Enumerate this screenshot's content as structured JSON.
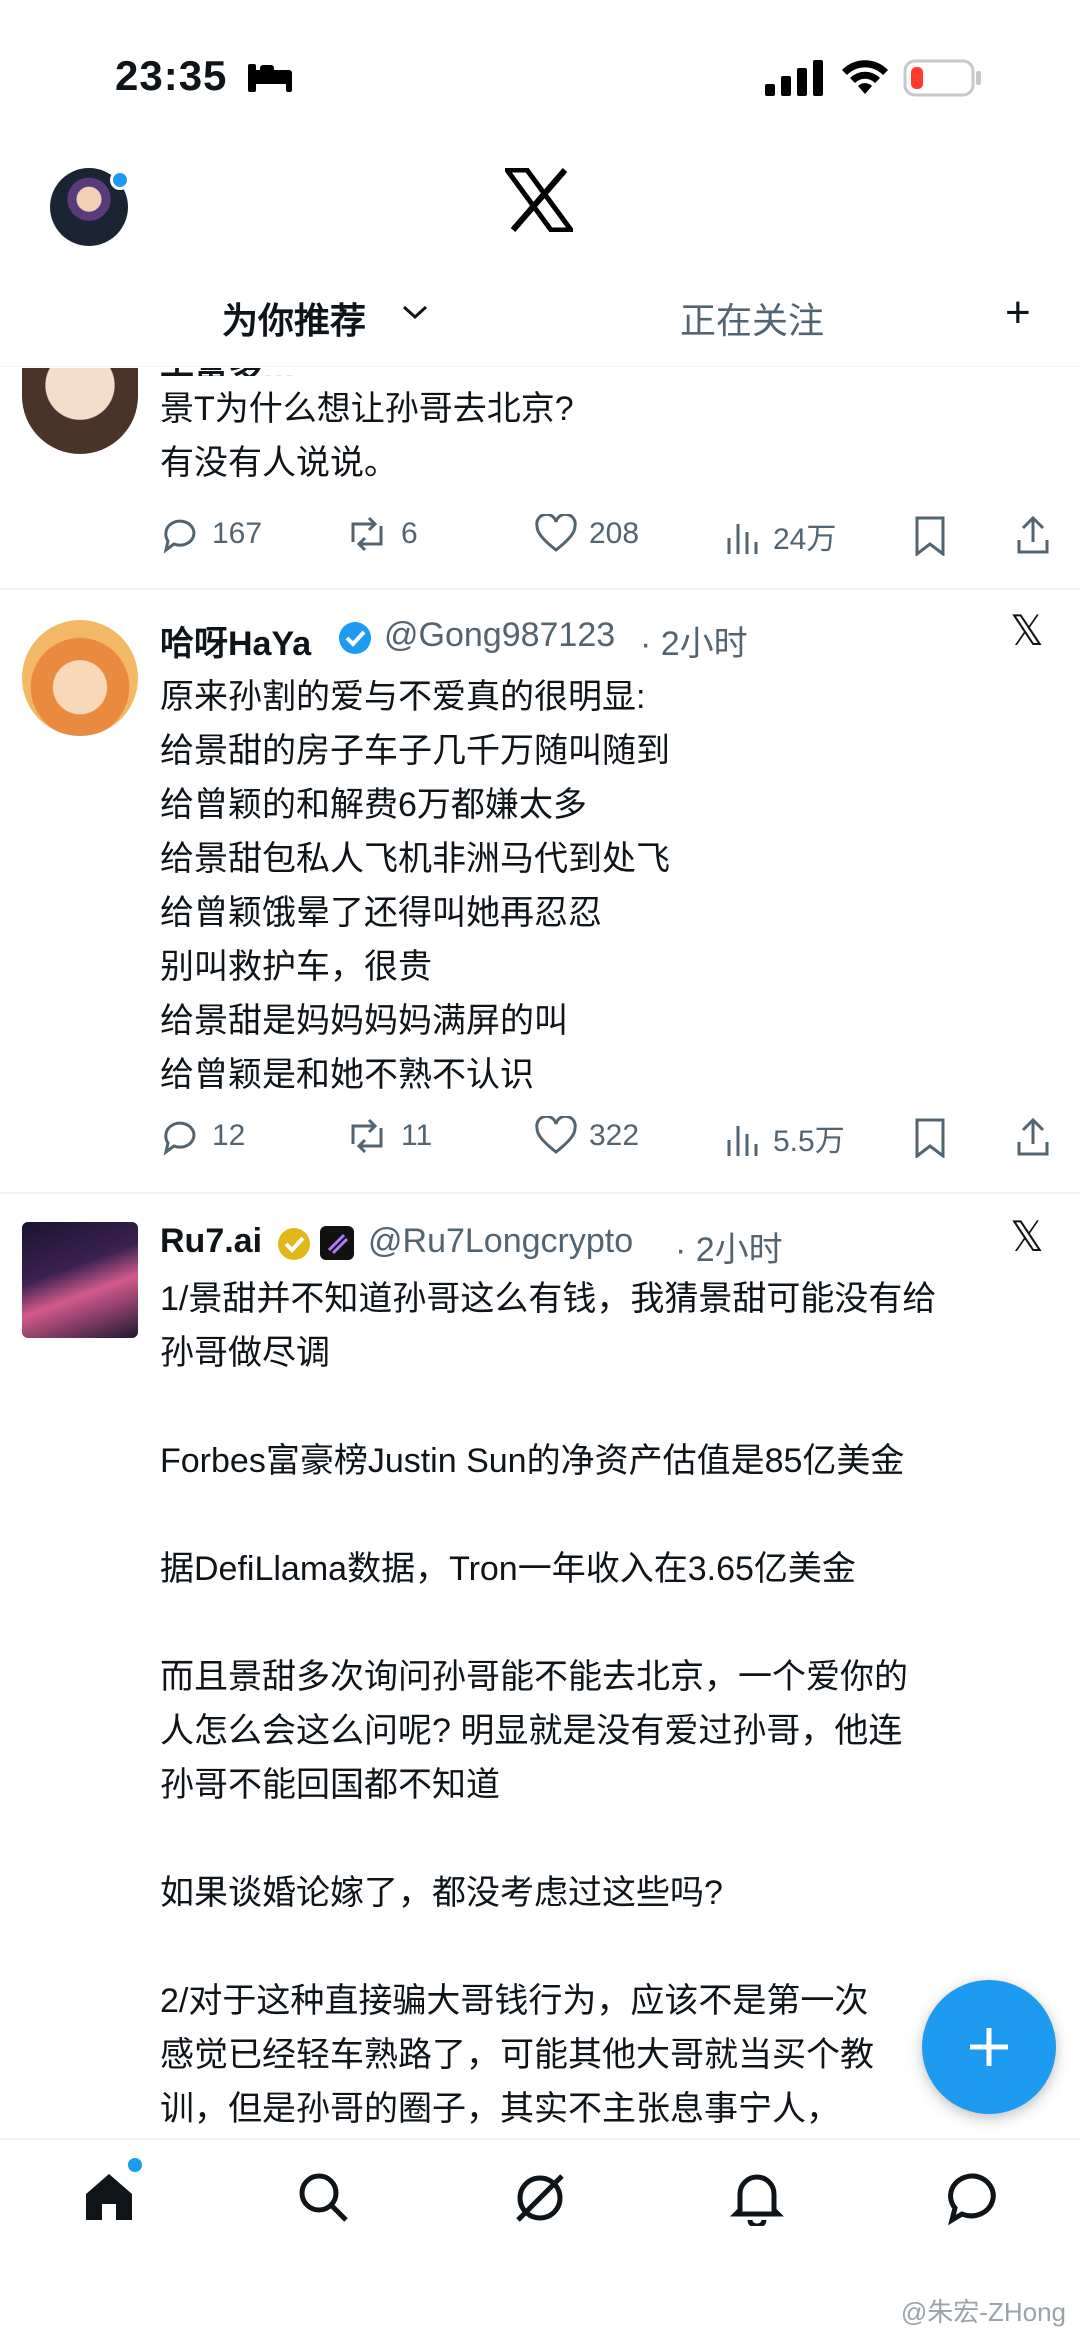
{
  "status_bar": {
    "time": "23:35"
  },
  "header": {
    "tab_for_you": "为你推荐",
    "tab_following": "正在关注",
    "add_tab": "+"
  },
  "posts": [
    {
      "truncated_header": "丰富多…",
      "body": "景T为什么想让孙哥去北京?\n有没有人说说。",
      "replies": "167",
      "reposts": "6",
      "likes": "208",
      "views": "24万"
    },
    {
      "name": "哈呀HaYa",
      "handle": "@Gong987123",
      "time": "· 2小时",
      "body": "原来孙割的爱与不爱真的很明显:\n给景甜的房子车子几千万随叫随到\n给曾颖的和解费6万都嫌太多\n给景甜包私人飞机非洲马代到处飞\n给曾颖饿晕了还得叫她再忍忍\n别叫救护车，很贵\n给景甜是妈妈妈妈满屏的叫\n给曾颖是和她不熟不认识",
      "replies": "12",
      "reposts": "11",
      "likes": "322",
      "views": "5.5万"
    },
    {
      "name": "Ru7.ai",
      "handle": "@Ru7Longcrypto",
      "time": "· 2小时",
      "body": "1/景甜并不知道孙哥这么有钱，我猜景甜可能没有给\n孙哥做尽调\n\nForbes富豪榜Justin Sun的净资产估值是85亿美金\n\n据DefiLlama数据，Tron一年收入在3.65亿美金\n\n而且景甜多次询问孙哥能不能去北京，一个爱你的\n人怎么会这么问呢? 明显就是没有爱过孙哥，他连\n孙哥不能回国都不知道\n\n如果谈婚论嫁了，都没考虑过这些吗?\n\n2/对于这种直接骗大哥钱行为，应该不是第一次\n感觉已经轻车熟路了，可能其他大哥就当买个教\n训，但是孙哥的圈子，其实不主张息事宁人，\n有没有那么多敬畏，不像国内富二代富三代"
    }
  ],
  "watermark": "@朱宏-ZHong",
  "colors": {
    "accent": "#1d9bf0",
    "secondary_text": "#536471",
    "verified_blue": "#1d9bf0",
    "verified_gold": "#e2b719"
  }
}
